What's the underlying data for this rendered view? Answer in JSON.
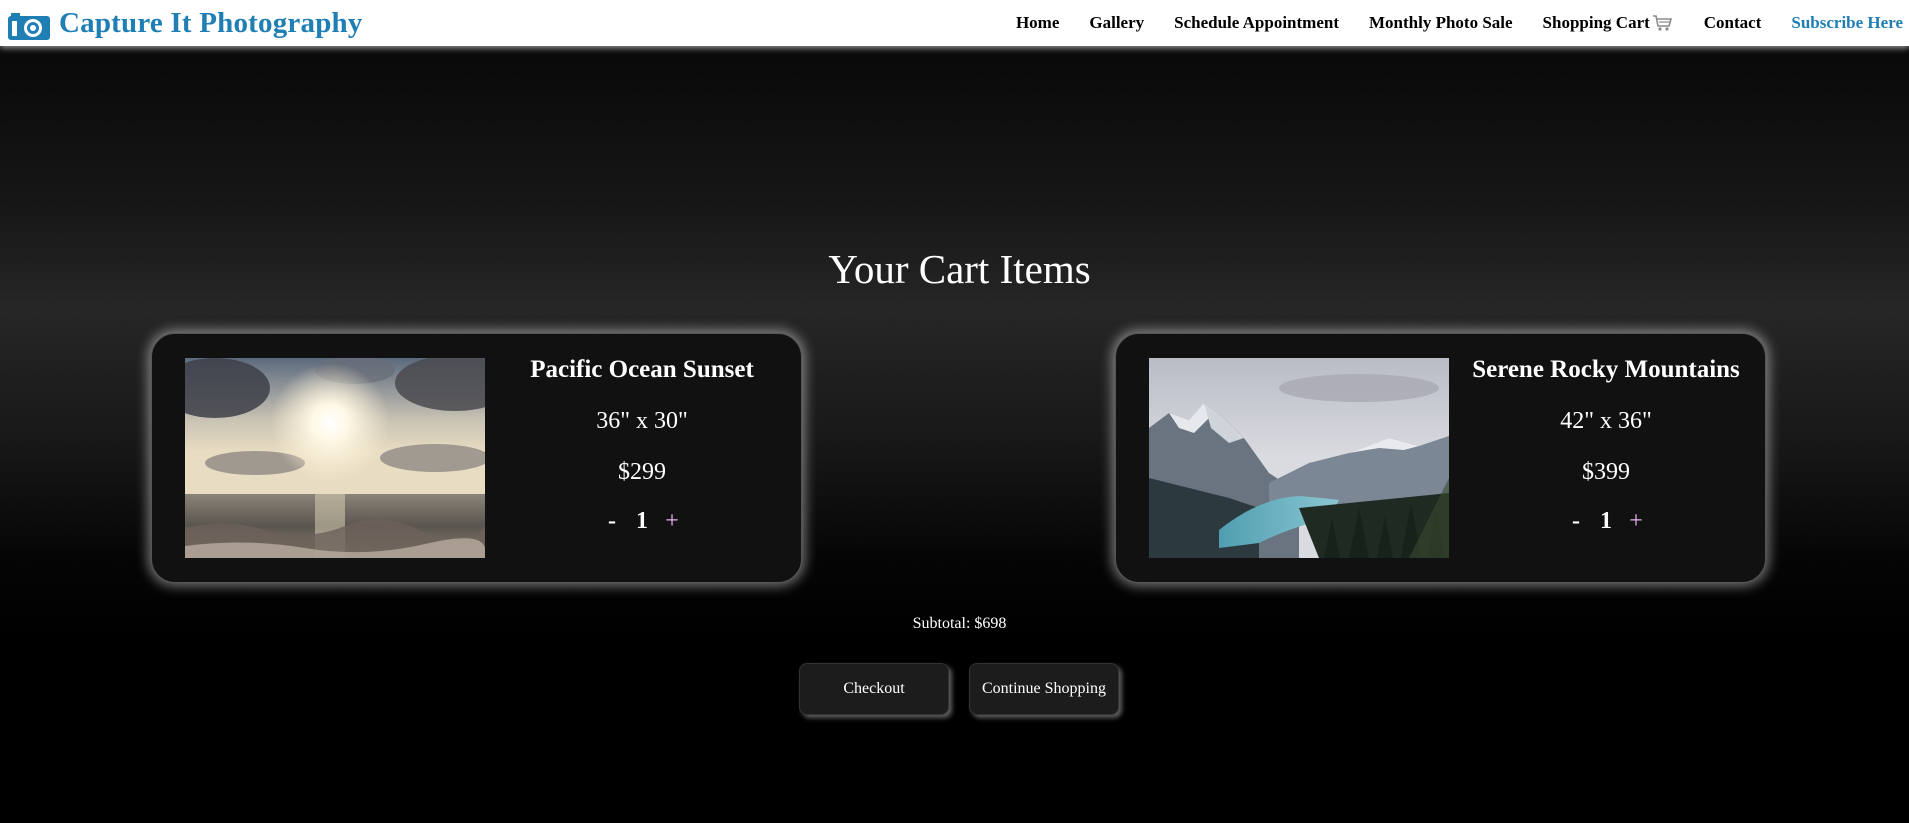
{
  "brand": {
    "name": "Capture It Photography",
    "icon": "camera-icon",
    "color": "#1f7fb5"
  },
  "nav": {
    "items": [
      {
        "label": "Home"
      },
      {
        "label": "Gallery"
      },
      {
        "label": "Schedule Appointment"
      },
      {
        "label": "Monthly Photo Sale"
      },
      {
        "label": "Shopping Cart",
        "icon": "cart-icon"
      },
      {
        "label": "Contact"
      },
      {
        "label": "Subscribe Here",
        "color": "#1f7fb5"
      }
    ]
  },
  "main": {
    "title": "Your Cart Items",
    "items": [
      {
        "name": "Pacific Ocean Sunset",
        "size": "36\" x 30\"",
        "price": "$299",
        "qty_minus": "-",
        "quantity": "1",
        "qty_plus": "+"
      },
      {
        "name": "Serene Rocky Mountains",
        "size": "42\" x 36\"",
        "price": "$399",
        "qty_minus": "-",
        "quantity": "1",
        "qty_plus": "+"
      }
    ],
    "subtotal": "Subtotal: $698",
    "checkout_label": "Checkout",
    "continue_label": "Continue Shopping"
  }
}
